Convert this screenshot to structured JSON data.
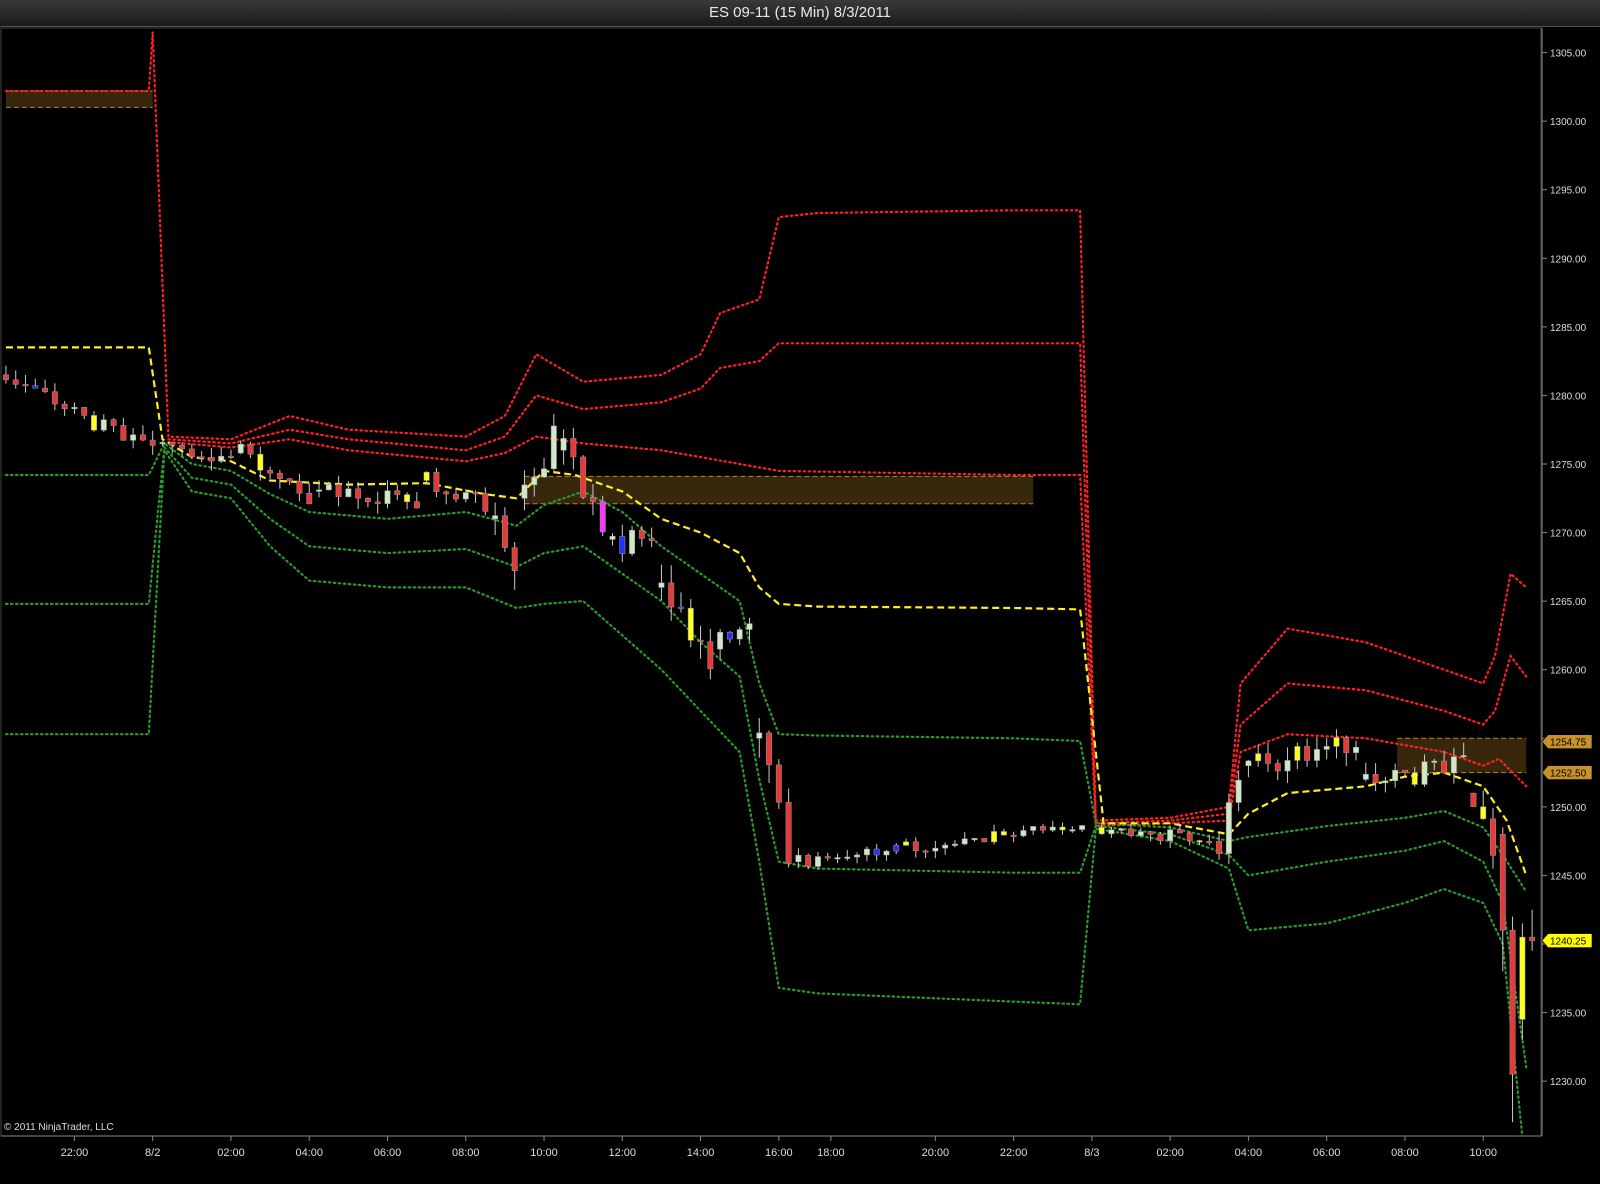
{
  "window": {
    "title": "ES 09-11 (15 Min)  8/3/2011"
  },
  "footer": {
    "copyright": "© 2011 NinjaTrader, LLC"
  },
  "colors": {
    "background": "#000000",
    "grid": "#222222",
    "axis_text": "#dddddd",
    "bull_candle": "#cfe8c8",
    "bear_candle": "#e53a3a",
    "yellow_candle": "#ffff22",
    "blue_candle": "#2233ff",
    "magenta_candle": "#ff33ff",
    "vwap": "#ffee22",
    "upper_band": "#ff2020",
    "lower_band": "#2a9a2a",
    "zone_fill": "#3a2a0e",
    "zone_border": "#b8862a",
    "tag_bronze": "#c8922a",
    "tag_yellow": "#ffff00"
  },
  "chart_data": {
    "type": "candlestick",
    "title": "ES 09-11 (15 Min)  8/3/2011",
    "ylim": [
      1226,
      1306.5
    ],
    "y_ticks": [
      "1305.00",
      "1300.00",
      "1295.00",
      "1290.00",
      "1285.00",
      "1280.00",
      "1275.00",
      "1270.00",
      "1265.00",
      "1260.00",
      "1255.00",
      "1250.00",
      "1245.00",
      "1240.00",
      "1235.00",
      "1230.00"
    ],
    "x_ticks": [
      "22:00",
      "8/2",
      "02:00",
      "04:00",
      "06:00",
      "08:00",
      "10:00",
      "12:00",
      "14:00",
      "16:00",
      "18:00",
      "20:00",
      "22:00",
      "8/3",
      "02:00",
      "04:00",
      "06:00",
      "08:00",
      "10:00"
    ],
    "x_tick_hours": [
      -2,
      0,
      2,
      4,
      6,
      8,
      10,
      12,
      14,
      16,
      17.33,
      20,
      22,
      24,
      26,
      28,
      30,
      32,
      34
    ],
    "x_range_hours": [
      -3.8,
      35.4
    ],
    "price_tags": [
      {
        "label": "1254.75",
        "price": 1254.75,
        "style": "bronze"
      },
      {
        "label": "1252.50",
        "price": 1252.5,
        "style": "bronze"
      },
      {
        "label": "1240.25",
        "price": 1240.25,
        "style": "yellow"
      }
    ],
    "zones": [
      {
        "start": -3.75,
        "end": 0,
        "top": 1302.2,
        "bottom": 1301.0
      },
      {
        "start": 9.5,
        "end": 22.5,
        "top": 1274.1,
        "bottom": 1272.1
      },
      {
        "start": 31.8,
        "end": 35.1,
        "top": 1255.0,
        "bottom": 1252.5
      }
    ],
    "vwap": {
      "name": "VWAP",
      "points": [
        [
          -3.75,
          1283.5
        ],
        [
          -0.1,
          1283.5
        ],
        [
          0.25,
          1276.8
        ],
        [
          1,
          1275.5
        ],
        [
          2,
          1275.2
        ],
        [
          3,
          1273.8
        ],
        [
          5,
          1273.5
        ],
        [
          7,
          1273.6
        ],
        [
          8.5,
          1272.8
        ],
        [
          9.3,
          1272.5
        ],
        [
          10,
          1274.5
        ],
        [
          10.8,
          1274.2
        ],
        [
          12,
          1273
        ],
        [
          13,
          1271
        ],
        [
          14,
          1270
        ],
        [
          15,
          1268.5
        ],
        [
          15.5,
          1266
        ],
        [
          16,
          1264.8
        ],
        [
          17,
          1264.6
        ],
        [
          22,
          1264.5
        ],
        [
          23.7,
          1264.4
        ],
        [
          24.3,
          1248.8
        ],
        [
          26,
          1248.8
        ],
        [
          27.5,
          1248.0
        ],
        [
          28,
          1249.5
        ],
        [
          29,
          1251
        ],
        [
          31,
          1251.5
        ],
        [
          32,
          1252.2
        ],
        [
          33,
          1252.5
        ],
        [
          34,
          1251.5
        ],
        [
          34.6,
          1249
        ],
        [
          35.1,
          1245
        ]
      ]
    },
    "bands": [
      {
        "name": "Upper Band 3",
        "side": "upper",
        "points": [
          [
            -3.75,
            1302.2
          ],
          [
            -0.1,
            1302.2
          ],
          [
            0,
            1306.5
          ],
          [
            0.4,
            1277
          ],
          [
            2,
            1276.8
          ],
          [
            3.5,
            1278.5
          ],
          [
            5,
            1277.5
          ],
          [
            8,
            1277
          ],
          [
            9,
            1278.5
          ],
          [
            9.8,
            1283
          ],
          [
            11,
            1281
          ],
          [
            13,
            1281.5
          ],
          [
            14,
            1283
          ],
          [
            14.5,
            1286
          ],
          [
            15.5,
            1287
          ],
          [
            16,
            1293
          ],
          [
            17,
            1293.3
          ],
          [
            22,
            1293.5
          ],
          [
            23.7,
            1293.5
          ],
          [
            24.1,
            1249
          ],
          [
            26,
            1249.2
          ],
          [
            27.5,
            1250
          ],
          [
            27.8,
            1259
          ],
          [
            29,
            1263
          ],
          [
            31,
            1262
          ],
          [
            33,
            1260
          ],
          [
            34,
            1259
          ],
          [
            34.3,
            1261
          ],
          [
            34.7,
            1267
          ],
          [
            35.1,
            1266
          ]
        ]
      },
      {
        "name": "Upper Band 2",
        "side": "upper",
        "points": [
          [
            0.4,
            1276.8
          ],
          [
            2,
            1276.5
          ],
          [
            3.5,
            1277.5
          ],
          [
            5,
            1276.8
          ],
          [
            8,
            1276
          ],
          [
            9,
            1277
          ],
          [
            9.8,
            1280
          ],
          [
            11,
            1279
          ],
          [
            13,
            1279.5
          ],
          [
            14,
            1280.5
          ],
          [
            14.5,
            1282
          ],
          [
            15.5,
            1282.5
          ],
          [
            16,
            1283.8
          ],
          [
            22,
            1283.8
          ],
          [
            23.7,
            1283.8
          ],
          [
            24.1,
            1248.8
          ],
          [
            26,
            1249
          ],
          [
            27.5,
            1249.5
          ],
          [
            27.8,
            1256
          ],
          [
            29,
            1259
          ],
          [
            31,
            1258.5
          ],
          [
            33,
            1257
          ],
          [
            34,
            1256
          ],
          [
            34.3,
            1257
          ],
          [
            34.7,
            1261
          ],
          [
            35.1,
            1259.5
          ]
        ]
      },
      {
        "name": "Upper Band 1",
        "side": "upper",
        "points": [
          [
            0.4,
            1276.6
          ],
          [
            2,
            1276.2
          ],
          [
            3.5,
            1276.8
          ],
          [
            5,
            1276
          ],
          [
            8,
            1275.2
          ],
          [
            9,
            1275.8
          ],
          [
            9.8,
            1277
          ],
          [
            11,
            1276.5
          ],
          [
            13,
            1276
          ],
          [
            14,
            1275.5
          ],
          [
            16,
            1274.5
          ],
          [
            22,
            1274.2
          ],
          [
            23.7,
            1274.2
          ],
          [
            24.1,
            1248.6
          ],
          [
            26,
            1248.8
          ],
          [
            27.5,
            1249
          ],
          [
            27.8,
            1254
          ],
          [
            29,
            1255.3
          ],
          [
            31,
            1255
          ],
          [
            33,
            1254
          ],
          [
            34,
            1253
          ],
          [
            34.4,
            1253.5
          ],
          [
            35.1,
            1251.5
          ]
        ]
      },
      {
        "name": "Lower Band 1",
        "side": "lower",
        "points": [
          [
            -3.75,
            1274.2
          ],
          [
            -0.1,
            1274.2
          ],
          [
            0.3,
            1276.5
          ],
          [
            1,
            1275
          ],
          [
            2,
            1274.5
          ],
          [
            3,
            1272.8
          ],
          [
            4,
            1271.5
          ],
          [
            6,
            1271
          ],
          [
            8,
            1271.5
          ],
          [
            9.3,
            1270.5
          ],
          [
            10,
            1272
          ],
          [
            11,
            1273
          ],
          [
            12,
            1271.5
          ],
          [
            13,
            1269
          ],
          [
            14,
            1267
          ],
          [
            15,
            1265
          ],
          [
            15.5,
            1259
          ],
          [
            16,
            1255.3
          ],
          [
            17,
            1255.2
          ],
          [
            22,
            1255
          ],
          [
            23.7,
            1254.8
          ],
          [
            24.1,
            1248.8
          ],
          [
            26,
            1248.5
          ],
          [
            27.5,
            1247.5
          ],
          [
            28,
            1247.8
          ],
          [
            30,
            1248.6
          ],
          [
            32,
            1249.2
          ],
          [
            33,
            1249.7
          ],
          [
            34,
            1248.5
          ],
          [
            34.5,
            1246.5
          ],
          [
            35.1,
            1243.8
          ]
        ]
      },
      {
        "name": "Lower Band 2",
        "side": "lower",
        "points": [
          [
            -3.75,
            1264.8
          ],
          [
            -0.1,
            1264.8
          ],
          [
            0.3,
            1276.2
          ],
          [
            1,
            1274
          ],
          [
            2,
            1273.5
          ],
          [
            3,
            1271
          ],
          [
            4,
            1269
          ],
          [
            6,
            1268.5
          ],
          [
            8,
            1268.8
          ],
          [
            9.3,
            1267.5
          ],
          [
            10,
            1268.5
          ],
          [
            11,
            1269
          ],
          [
            12,
            1267
          ],
          [
            13,
            1265
          ],
          [
            14,
            1262
          ],
          [
            15,
            1259.5
          ],
          [
            15.5,
            1252
          ],
          [
            16,
            1246
          ],
          [
            17,
            1245.5
          ],
          [
            22,
            1245.2
          ],
          [
            23.7,
            1245.2
          ],
          [
            24.1,
            1248.6
          ],
          [
            26,
            1248
          ],
          [
            27.5,
            1246.5
          ],
          [
            28,
            1245
          ],
          [
            30,
            1246
          ],
          [
            32,
            1246.8
          ],
          [
            33,
            1247.5
          ],
          [
            34,
            1246
          ],
          [
            34.5,
            1243
          ],
          [
            35.1,
            1231
          ]
        ]
      },
      {
        "name": "Lower Band 3",
        "side": "lower",
        "points": [
          [
            -3.75,
            1255.3
          ],
          [
            -0.1,
            1255.3
          ],
          [
            0.3,
            1276
          ],
          [
            1,
            1273
          ],
          [
            2,
            1272.5
          ],
          [
            3,
            1269
          ],
          [
            4,
            1266.5
          ],
          [
            6,
            1266
          ],
          [
            8,
            1266
          ],
          [
            9.3,
            1264.5
          ],
          [
            10,
            1264.8
          ],
          [
            11,
            1265
          ],
          [
            12,
            1262.5
          ],
          [
            13,
            1260
          ],
          [
            14,
            1257
          ],
          [
            15,
            1254
          ],
          [
            15.5,
            1246
          ],
          [
            16,
            1236.8
          ],
          [
            17,
            1236.4
          ],
          [
            22,
            1235.8
          ],
          [
            23.7,
            1235.6
          ],
          [
            24.1,
            1248.4
          ],
          [
            26,
            1247.5
          ],
          [
            27.5,
            1245.5
          ],
          [
            28,
            1241
          ],
          [
            30,
            1241.5
          ],
          [
            32,
            1243
          ],
          [
            33,
            1244
          ],
          [
            34,
            1243
          ],
          [
            34.5,
            1240
          ],
          [
            35,
            1226
          ]
        ]
      }
    ],
    "candle_segments": [
      {
        "t0": -3.75,
        "t1": 0,
        "p0": 1281.5,
        "p1": 1275.8,
        "vol": 0.8,
        "seed": 3
      },
      {
        "t0": 0.25,
        "t1": 2.0,
        "p0": 1276.5,
        "p1": 1275.5,
        "vol": 0.8,
        "seed": 7
      },
      {
        "t0": 2.25,
        "t1": 4.0,
        "p0": 1275.8,
        "p1": 1272.3,
        "vol": 1.0,
        "seed": 11
      },
      {
        "t0": 4.25,
        "t1": 6.75,
        "p0": 1273.0,
        "p1": 1272.5,
        "vol": 0.9,
        "seed": 13
      },
      {
        "t0": 7.0,
        "t1": 8.5,
        "p0": 1273.8,
        "p1": 1272.0,
        "vol": 0.9,
        "seed": 17
      },
      {
        "t0": 8.75,
        "t1": 9.25,
        "p0": 1271.0,
        "p1": 1268.0,
        "vol": 1.6,
        "seed": 19
      },
      {
        "t0": 9.5,
        "t1": 10.25,
        "p0": 1272.5,
        "p1": 1277.0,
        "vol": 1.4,
        "seed": 23
      },
      {
        "t0": 10.5,
        "t1": 11.5,
        "p0": 1276.0,
        "p1": 1271.0,
        "vol": 1.2,
        "seed": 29
      },
      {
        "t0": 11.75,
        "t1": 12.75,
        "p0": 1269.5,
        "p1": 1269.0,
        "vol": 1.2,
        "seed": 31
      },
      {
        "t0": 13.0,
        "t1": 14.25,
        "p0": 1266.0,
        "p1": 1260.0,
        "vol": 1.5,
        "seed": 37
      },
      {
        "t0": 14.5,
        "t1": 15.25,
        "p0": 1261.5,
        "p1": 1262.5,
        "vol": 1.6,
        "seed": 41
      },
      {
        "t0": 15.5,
        "t1": 16.25,
        "p0": 1255.0,
        "p1": 1247.0,
        "vol": 1.6,
        "seed": 43
      },
      {
        "t0": 16.5,
        "t1": 23.75,
        "p0": 1246.0,
        "p1": 1248.8,
        "vol": 0.6,
        "seed": 47
      },
      {
        "t0": 24.25,
        "t1": 27.0,
        "p0": 1248.5,
        "p1": 1247.5,
        "vol": 0.6,
        "seed": 53
      },
      {
        "t0": 27.25,
        "t1": 27.75,
        "p0": 1247.5,
        "p1": 1252.0,
        "vol": 1.2,
        "seed": 59
      },
      {
        "t0": 28.0,
        "t1": 30.75,
        "p0": 1253.0,
        "p1": 1254.5,
        "vol": 1.1,
        "seed": 61
      },
      {
        "t0": 31.0,
        "t1": 33.5,
        "p0": 1252.0,
        "p1": 1253.0,
        "vol": 1.1,
        "seed": 67
      },
      {
        "t0": 33.75,
        "t1": 34.25,
        "p0": 1251.0,
        "p1": 1247.0,
        "vol": 1.4,
        "seed": 71
      },
      {
        "t0": 34.5,
        "t1": 34.5,
        "p0": 1241.0,
        "p1": 1241.0,
        "vol": 2.0,
        "seed": 73
      }
    ],
    "special_candles": [
      {
        "t": 34.5,
        "o": 1248,
        "h": 1248.5,
        "c": 1241,
        "l": 1238,
        "color": "bear"
      },
      {
        "t": 34.75,
        "o": 1241,
        "h": 1242,
        "c": 1230.5,
        "l": 1227,
        "color": "bear"
      },
      {
        "t": 35.0,
        "o": 1234.5,
        "h": 1241.5,
        "c": 1240.5,
        "l": 1233,
        "color": "yellow"
      },
      {
        "t": 35.25,
        "o": 1240.5,
        "h": 1242.5,
        "c": 1240.25,
        "l": 1239.5,
        "color": "bear"
      }
    ]
  }
}
